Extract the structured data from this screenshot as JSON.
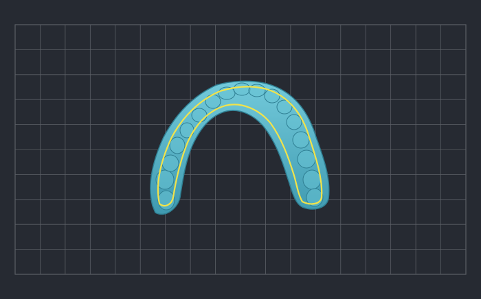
{
  "viewport": {
    "background_color": "#262a32",
    "grid_color": "#5b5f66",
    "grid_columns": 18,
    "grid_rows": 10,
    "model_color": "#5ab7cc",
    "model_shade_color": "#3e8fa3",
    "margin_line_color": "#f2e34a",
    "icons": [
      "dental-arch-model-icon",
      "margin-line-icon",
      "grid-icon"
    ]
  }
}
